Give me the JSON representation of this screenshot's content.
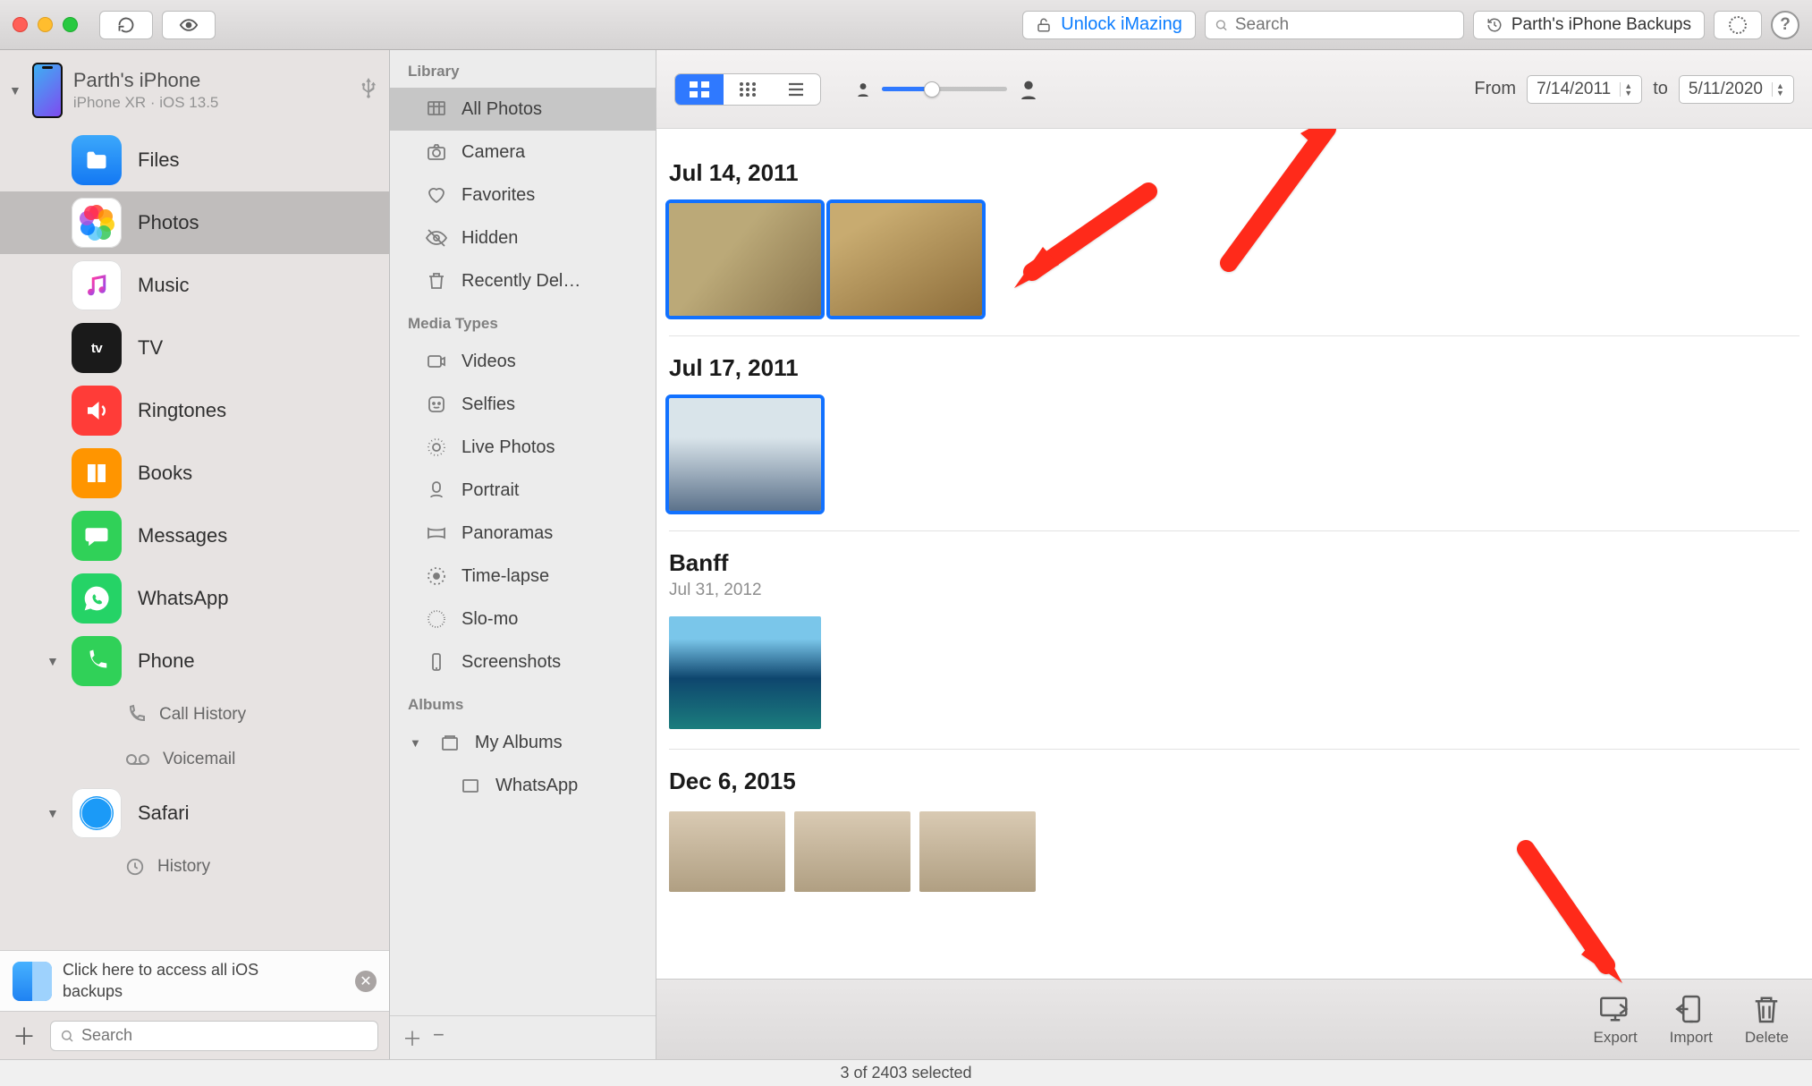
{
  "toolbar": {
    "unlock_label": "Unlock iMazing",
    "search_placeholder": "Search",
    "backups_label": "Parth's iPhone Backups"
  },
  "device": {
    "name": "Parth's iPhone",
    "subtitle": "iPhone XR · iOS 13.5"
  },
  "nav": {
    "files": "Files",
    "photos": "Photos",
    "music": "Music",
    "tv": "TV",
    "ringtones": "Ringtones",
    "books": "Books",
    "messages": "Messages",
    "whatsapp": "WhatsApp",
    "phone": "Phone",
    "call_history": "Call History",
    "voicemail": "Voicemail",
    "safari": "Safari",
    "history": "History"
  },
  "notice": {
    "text": "Click here to access all iOS backups"
  },
  "sidebar_footer": {
    "search_placeholder": "Search"
  },
  "library": {
    "header_library": "Library",
    "all_photos": "All Photos",
    "camera": "Camera",
    "favorites": "Favorites",
    "hidden": "Hidden",
    "recently_deleted": "Recently Del…",
    "header_media": "Media Types",
    "videos": "Videos",
    "selfies": "Selfies",
    "live_photos": "Live Photos",
    "portrait": "Portrait",
    "panoramas": "Panoramas",
    "timelapse": "Time-lapse",
    "slomo": "Slo-mo",
    "screenshots": "Screenshots",
    "header_albums": "Albums",
    "my_albums": "My Albums",
    "whatsapp": "WhatsApp"
  },
  "date_range": {
    "from_label": "From",
    "from_value": "7/14/2011",
    "to_label": "to",
    "to_value": "5/11/2020"
  },
  "sections": {
    "s1_title": "Jul 14, 2011",
    "s2_title": "Jul 17, 2011",
    "s3_title": "Banff",
    "s3_sub": "Jul 31, 2012",
    "s4_title": "Dec 6, 2015"
  },
  "actions": {
    "export": "Export",
    "import": "Import",
    "delete": "Delete"
  },
  "status": {
    "text": "3 of 2403 selected"
  }
}
